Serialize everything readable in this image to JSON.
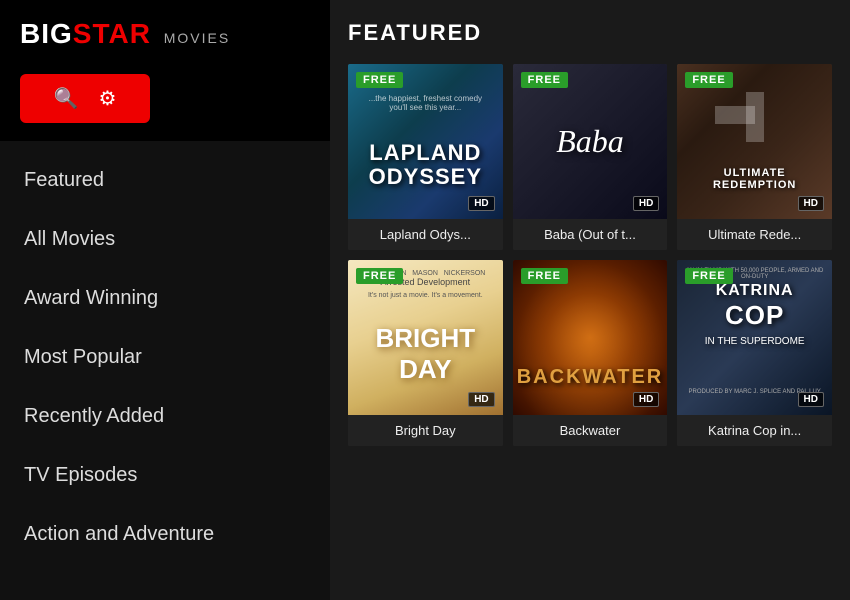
{
  "logo": {
    "big": "BIG",
    "star": "STAR",
    "movies": "MOVIES"
  },
  "sidebar": {
    "nav_items": [
      {
        "id": "featured",
        "label": "Featured"
      },
      {
        "id": "all-movies",
        "label": "All Movies"
      },
      {
        "id": "award-winning",
        "label": "Award Winning"
      },
      {
        "id": "most-popular",
        "label": "Most Popular"
      },
      {
        "id": "recently-added",
        "label": "Recently Added"
      },
      {
        "id": "tv-episodes",
        "label": "TV Episodes"
      },
      {
        "id": "action-adventure",
        "label": "Action and Adventure"
      }
    ]
  },
  "main": {
    "section_title": "FEATURED",
    "movies": [
      {
        "id": "lapland-odyssey",
        "title": "Lapland Odys...",
        "free": true,
        "hd": true,
        "poster_class": "poster-1",
        "poster_main_text": "LAPLAND\nODYSSEY",
        "poster_sub_text": "...The happiest, freshest comedy\nyou'll see this year..."
      },
      {
        "id": "baba",
        "title": "Baba (Out of t...",
        "free": true,
        "hd": true,
        "poster_class": "poster-2",
        "poster_main_text": "Baba",
        "poster_sub_text": ""
      },
      {
        "id": "ultimate-redemption",
        "title": "Ultimate Rede...",
        "free": true,
        "hd": true,
        "poster_class": "poster-3",
        "poster_main_text": "ULTIMATE\nREDEMPTION",
        "poster_sub_text": ""
      },
      {
        "id": "bright-day",
        "title": "Bright Day",
        "free": true,
        "hd": true,
        "poster_class": "poster-4",
        "poster_main_text": "BRIGHT\nDAY",
        "poster_sub_text": "It's not just a movie. It's a movement."
      },
      {
        "id": "backwater",
        "title": "Backwater",
        "free": true,
        "hd": true,
        "poster_class": "poster-5",
        "poster_main_text": "BACKWATER",
        "poster_sub_text": ""
      },
      {
        "id": "katrina-cop",
        "title": "Katrina Cop in...",
        "free": true,
        "hd": true,
        "poster_class": "poster-6",
        "poster_main_text": "KATRINA\nCOP\nIN THE SUPERDOME",
        "poster_sub_text": ""
      }
    ],
    "free_label": "FREE",
    "hd_label": "HD"
  }
}
